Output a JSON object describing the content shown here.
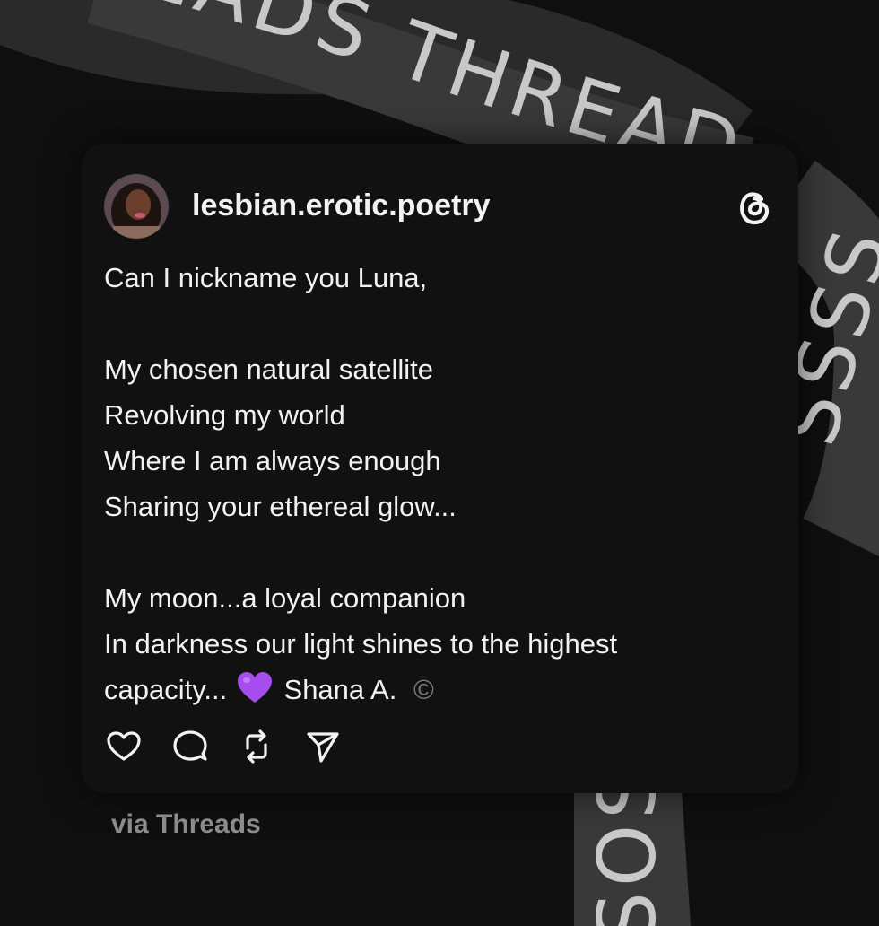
{
  "background": {
    "band_top_text": "EADS THREADS THR",
    "band_right_text": "SSSS",
    "band_bottom_text": "SOS"
  },
  "post": {
    "username": "lesbian.erotic.poetry",
    "lines": [
      "Can I nickname you Luna,",
      "",
      "My chosen natural satellite",
      "Revolving my world",
      "Where I am always enough",
      "Sharing your ethereal glow...",
      "",
      "My moon...a loyal companion",
      "In darkness our light shines to the highest"
    ],
    "last_line_start": "capacity...",
    "last_line_emoji": "purple-heart-icon",
    "last_line_end": "Shana A.",
    "copyright": "©"
  },
  "actions": {
    "icons": [
      "heart-icon",
      "comment-icon",
      "repost-icon",
      "share-icon"
    ]
  },
  "footer": {
    "via": "via Threads"
  },
  "colors": {
    "background": "#0f0f0f",
    "card": "#111111",
    "text": "#f2f2f2",
    "muted": "#8b8b8b",
    "band": "#3a3a3a",
    "heart": "#a64df0"
  }
}
